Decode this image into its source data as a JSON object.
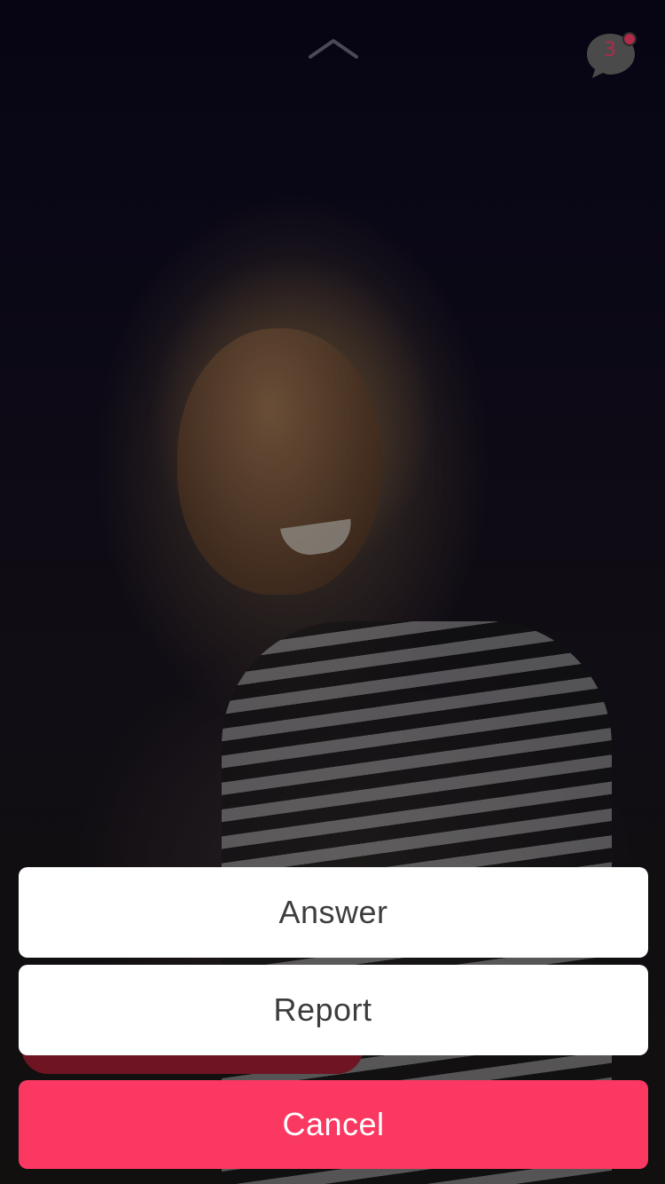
{
  "header": {
    "chat_icon": "chat-bubble-icon",
    "unread_count": "3",
    "accent_color": "#b02a4a"
  },
  "action_sheet": {
    "answer_label": "Answer",
    "report_label": "Report",
    "cancel_label": "Cancel",
    "cancel_color": "#fb3862"
  }
}
